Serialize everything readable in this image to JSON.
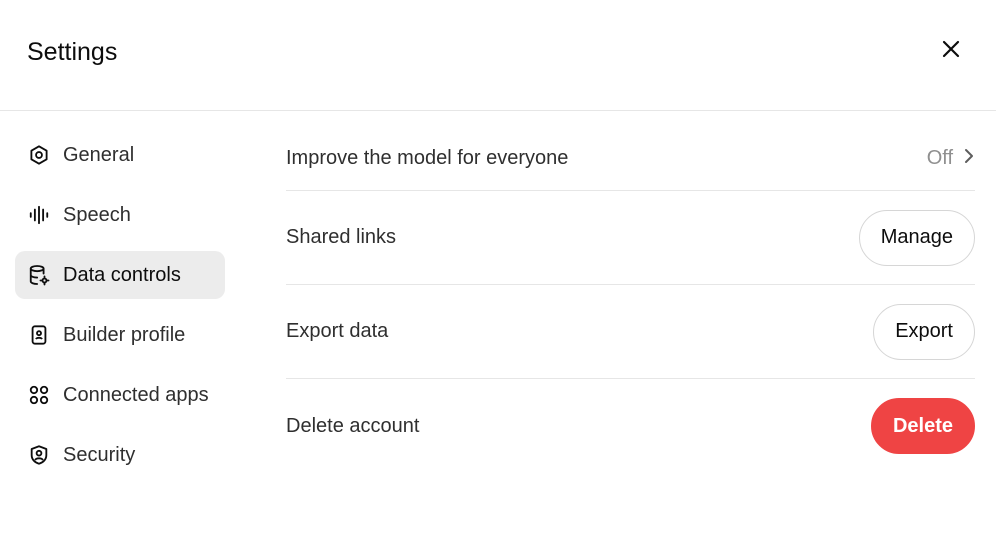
{
  "header": {
    "title": "Settings",
    "close_icon": "close-icon"
  },
  "sidebar": {
    "items": [
      {
        "label": "General",
        "icon": "gear-icon",
        "active": false
      },
      {
        "label": "Speech",
        "icon": "waveform-icon",
        "active": false
      },
      {
        "label": "Data controls",
        "icon": "database-settings-icon",
        "active": true
      },
      {
        "label": "Builder profile",
        "icon": "id-badge-icon",
        "active": false
      },
      {
        "label": "Connected apps",
        "icon": "apps-grid-icon",
        "active": false
      },
      {
        "label": "Security",
        "icon": "shield-user-icon",
        "active": false
      }
    ]
  },
  "main": {
    "rows": [
      {
        "label": "Improve the model for everyone",
        "value": "Off",
        "icon": "chevron-right-icon"
      },
      {
        "label": "Shared links",
        "button": "Manage"
      },
      {
        "label": "Export data",
        "button": "Export"
      },
      {
        "label": "Delete account",
        "button": "Delete"
      }
    ]
  },
  "colors": {
    "danger": "#ef4444",
    "active_bg": "#ececec",
    "muted_text": "#8f8f8f"
  }
}
